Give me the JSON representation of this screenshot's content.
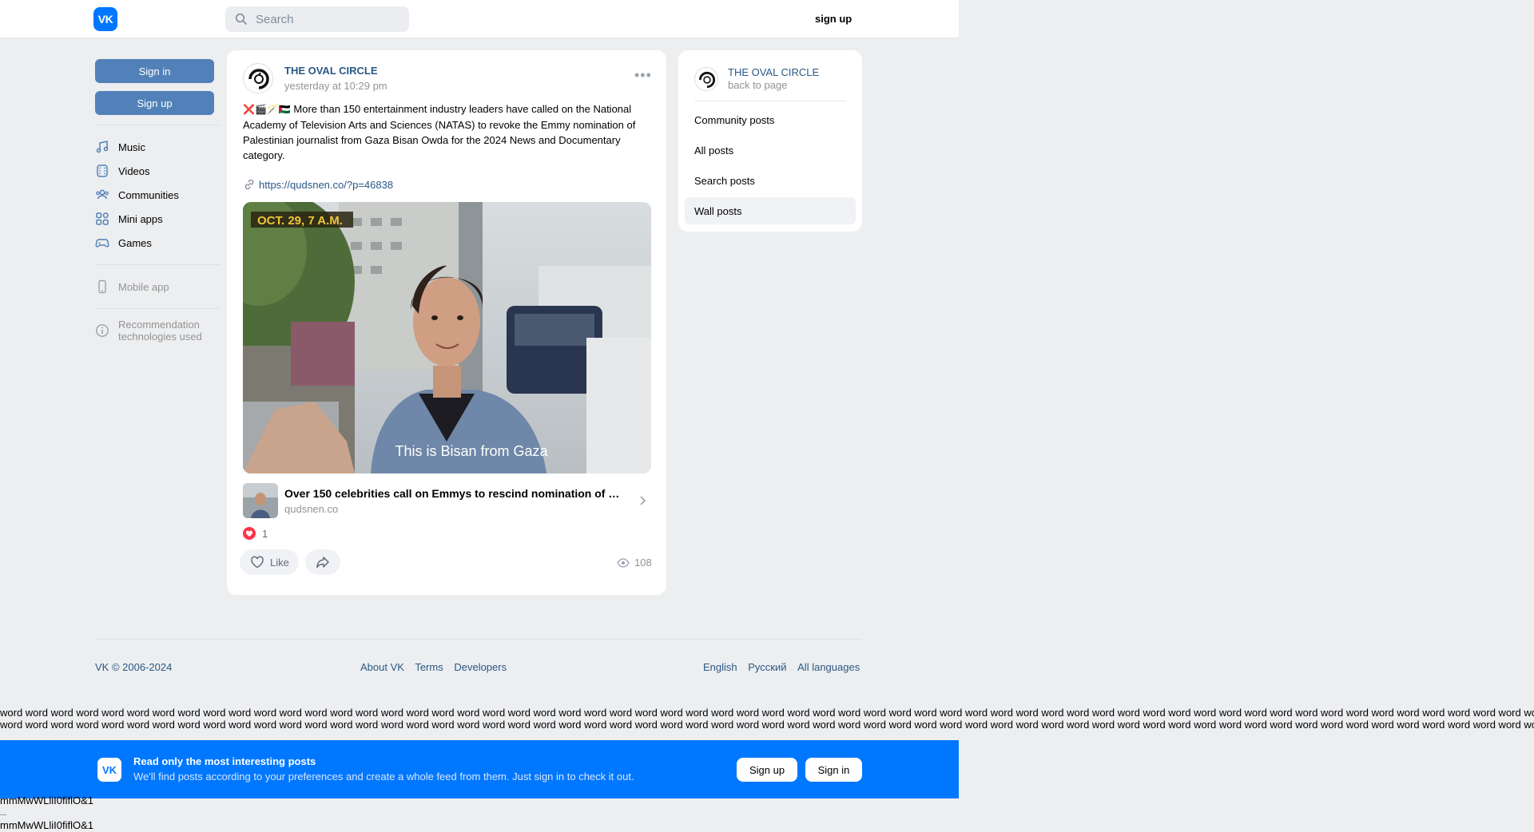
{
  "header": {
    "logo_text": "VK",
    "search_placeholder": "Search",
    "signup_label": "sign up"
  },
  "left": {
    "signin_label": "Sign in",
    "signup_label": "Sign up",
    "nav": [
      "Music",
      "Videos",
      "Communities",
      "Mini apps",
      "Games"
    ],
    "mobile_app": "Mobile app",
    "recommendation_line1": "Recommendation",
    "recommendation_line2": "technologies used"
  },
  "post": {
    "author": "THE OVAL CIRCLE",
    "time": "yesterday at 10:29 pm",
    "emojis": "❌🎬🪄🇵🇸",
    "text": "More than 150 entertainment industry leaders have called on the National Academy of Television Arts and Sciences (NATAS) to revoke the Emmy nomination of Palestinian journalist from Gaza Bisan Owda for the 2024 News and Documentary category.",
    "link": "https://qudsnen.co/?p=46838",
    "media_overlay_date": "OCT. 29, 7 A.M.",
    "media_caption": "This is Bisan from Gaza",
    "snippet_title": "Over 150 celebrities call on Emmys to rescind nomination of Ga...",
    "snippet_domain": "qudsnen.co",
    "reaction_count": "1",
    "like_label": "Like",
    "views": "108"
  },
  "right": {
    "name": "THE OVAL CIRCLE",
    "back": "back to page",
    "items": [
      "Community posts",
      "All posts",
      "Search posts",
      "Wall posts"
    ],
    "active_item": "Wall posts"
  },
  "footer": {
    "copyright": "VK © 2006-2024",
    "links": [
      "About VK",
      "Terms",
      "Developers"
    ],
    "languages": [
      "English",
      "Русский",
      "All languages"
    ]
  },
  "filler": {
    "words": "word word word word word word word word word word word word word word word word word word word word word word word word word word word word word word word word word word word word word word word word word word word word word word word word word word word word word word word word word word word word word word word word word word word word word word word word word word word word word"
  },
  "banner": {
    "title": "Read only the most interesting posts",
    "subtitle": "We'll find posts according to your preferences and create a whole feed from them. Just sign in to check it out.",
    "signup_label": "Sign up",
    "signin_label": "Sign in"
  },
  "junk": {
    "line1": "mmMwWLliI0fiflO&1",
    "line2": "mmMwWLliI0fiflO&1"
  },
  "colors": {
    "vk_blue": "#0077ff",
    "button_blue": "#5181b8",
    "link": "#2a5885",
    "background": "#edeef0"
  }
}
